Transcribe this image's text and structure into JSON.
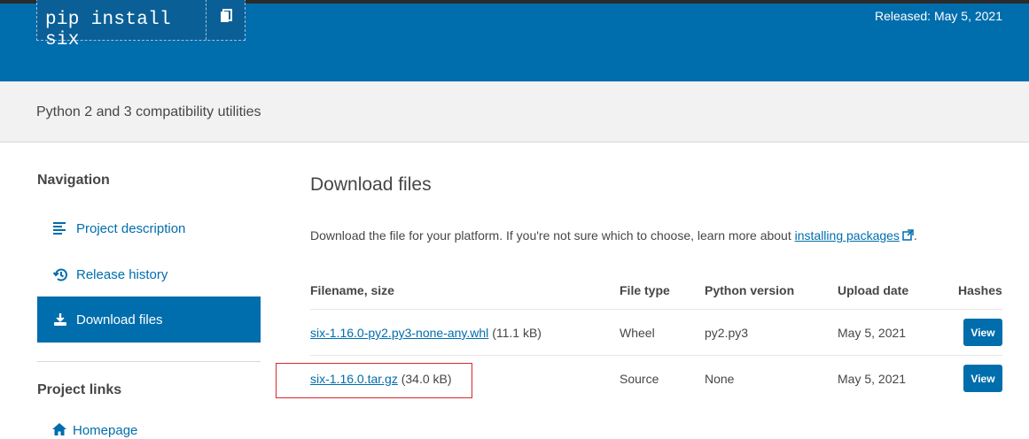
{
  "header": {
    "pip_command": "pip install six",
    "released": "Released: May 5, 2021",
    "copy_icon": "copy-icon"
  },
  "summary": "Python 2 and 3 compatibility utilities",
  "sidebar": {
    "heading": "Navigation",
    "items": [
      {
        "label": "Project description",
        "icon": "list-icon",
        "active": false
      },
      {
        "label": "Release history",
        "icon": "history-icon",
        "active": false
      },
      {
        "label": "Download files",
        "icon": "download-icon",
        "active": true
      }
    ],
    "links_heading": "Project links",
    "links": [
      {
        "label": "Homepage",
        "icon": "home-icon"
      }
    ]
  },
  "main": {
    "title": "Download files",
    "intro_text": "Download the file for your platform. If you're not sure which to choose, learn more about ",
    "intro_link": "installing packages",
    "intro_suffix": ".",
    "table": {
      "headers": [
        "Filename, size",
        "File type",
        "Python version",
        "Upload date",
        "Hashes"
      ],
      "rows": [
        {
          "filename": "six-1.16.0-py2.py3-none-any.whl",
          "size": "(11.1 kB)",
          "file_type": "Wheel",
          "python_version": "py2.py3",
          "upload_date": "May 5, 2021",
          "action": "View"
        },
        {
          "filename": "six-1.16.0.tar.gz",
          "size": "(34.0 kB)",
          "file_type": "Source",
          "python_version": "None",
          "upload_date": "May 5, 2021",
          "action": "View"
        }
      ]
    }
  },
  "colors": {
    "brand_blue": "#006dad",
    "highlight_red": "#d9282f"
  }
}
